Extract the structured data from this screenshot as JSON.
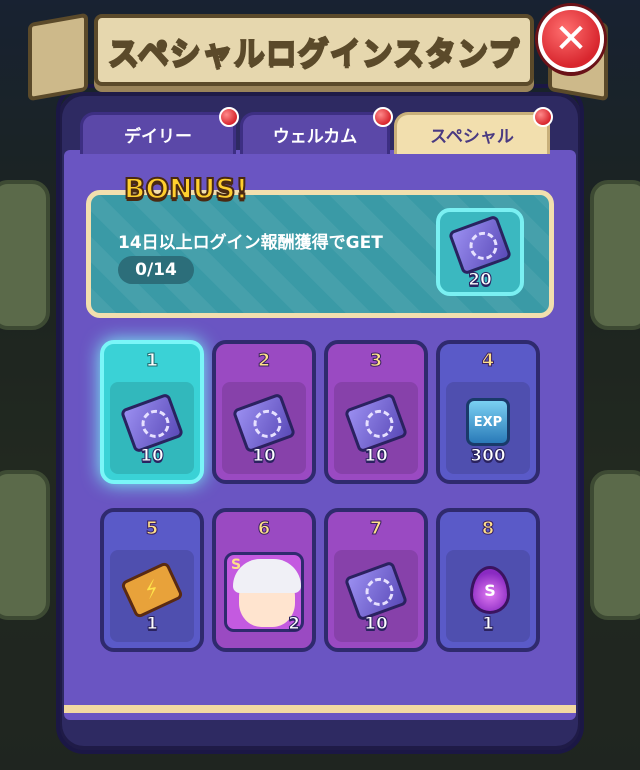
{
  "title": "スペシャルログインスタンプ",
  "close_symbol": "✕",
  "tabs": [
    {
      "label": "デイリー",
      "active": false,
      "badge": true
    },
    {
      "label": "ウェルカム",
      "active": false,
      "badge": true
    },
    {
      "label": "スペシャル",
      "active": true,
      "badge": true
    }
  ],
  "bonus": {
    "label": "BONUS!",
    "text": "14日以上ログイン報酬獲得でGET",
    "progress": "0/14",
    "reward_icon": "pick-ticket-icon",
    "reward_count": "20"
  },
  "days": [
    {
      "day": "1",
      "icon": "pick-ticket-icon",
      "count": "10",
      "state": "current"
    },
    {
      "day": "2",
      "icon": "pick-ticket-icon",
      "count": "10",
      "state": "purple"
    },
    {
      "day": "3",
      "icon": "pick-ticket-icon",
      "count": "10",
      "state": "purple"
    },
    {
      "day": "4",
      "icon": "exp-potion-icon",
      "count": "300",
      "state": "blue",
      "icon_text": "EXP"
    },
    {
      "day": "5",
      "icon": "stamina-charge-icon",
      "count": "1",
      "state": "blue"
    },
    {
      "day": "6",
      "icon": "hero-portrait-icon",
      "count": "2",
      "state": "purple",
      "icon_text": "S"
    },
    {
      "day": "7",
      "icon": "pick-ticket-icon",
      "count": "10",
      "state": "purple"
    },
    {
      "day": "8",
      "icon": "soul-flame-icon",
      "count": "1",
      "state": "blue",
      "icon_text": "S"
    }
  ],
  "colors": {
    "panel": "#2e2a62",
    "active_tab": "#f2dfae",
    "current_day": "#3ad2d6",
    "purple_day": "#9a4ac2",
    "blue_day": "#5a5ac8",
    "bonus_bg": "#3a9aa6",
    "close": "#d8262e"
  }
}
